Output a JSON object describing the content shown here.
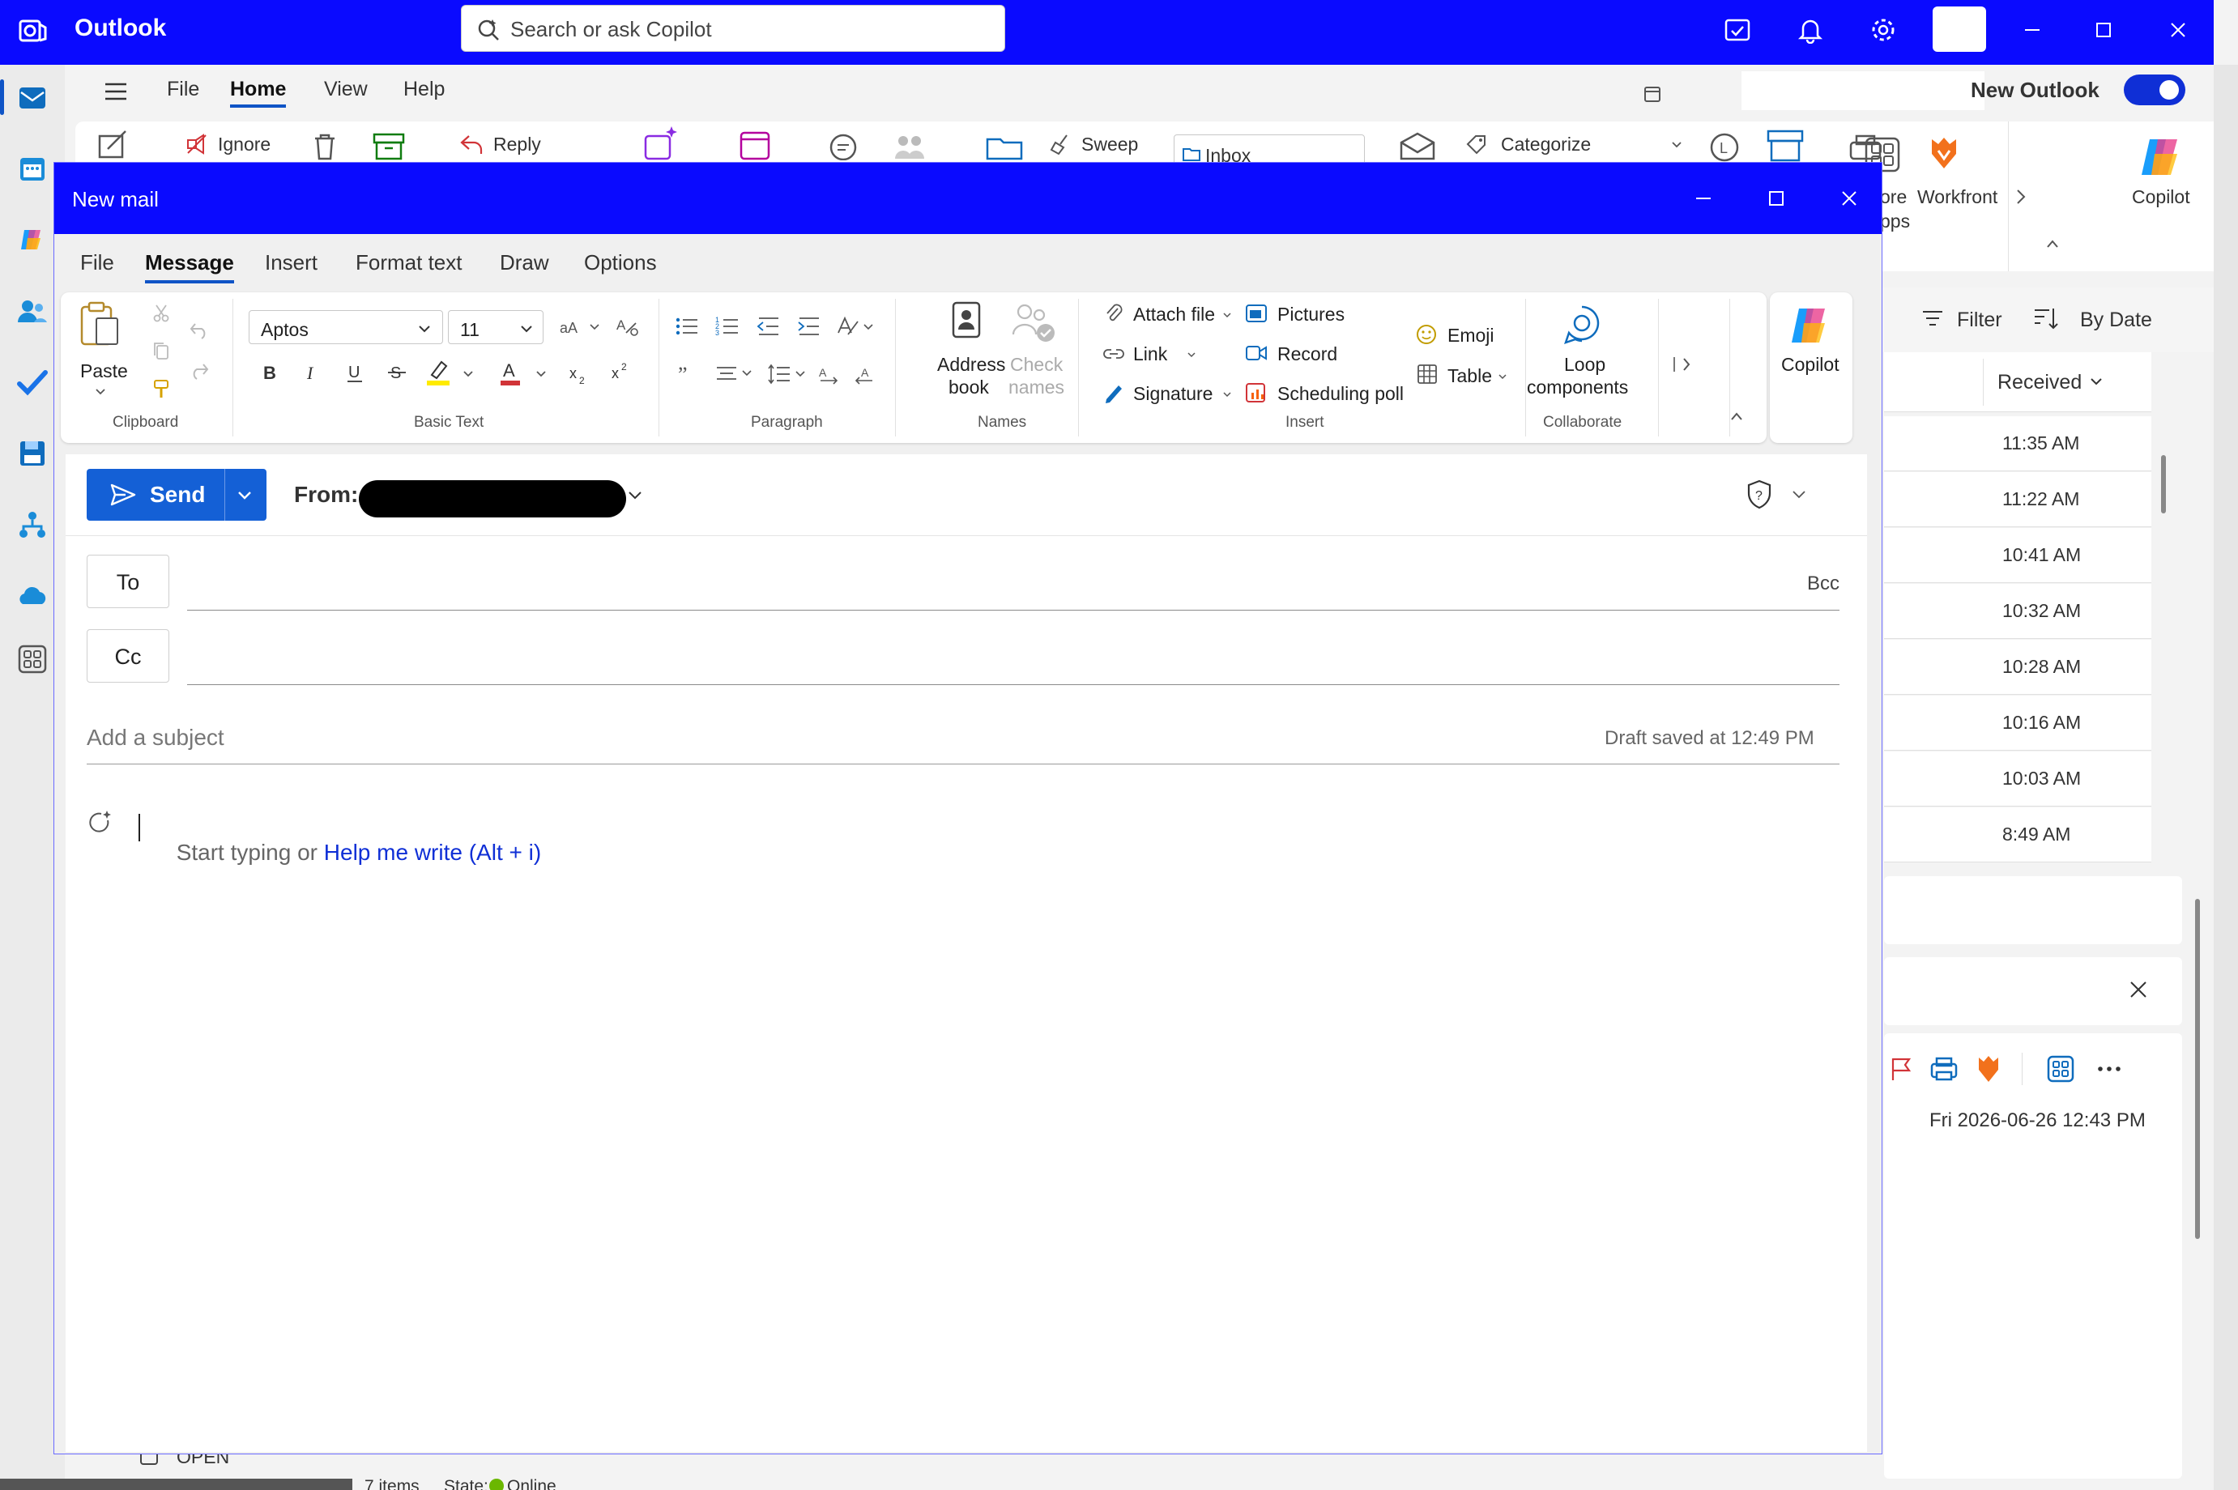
{
  "app": {
    "title": "Outlook",
    "search_placeholder": "Search or ask Copilot",
    "new_outlook_label": "New Outlook",
    "new_outlook_on": true
  },
  "outlook_menu": [
    "File",
    "Home",
    "View",
    "Help"
  ],
  "outlook_ribbon": {
    "ignore": "Ignore",
    "reply": "Reply",
    "sweep": "Sweep",
    "inbox": "Inbox",
    "categorize": "Categorize",
    "more_apps_a": "ore",
    "more_apps_b": "pps",
    "workfront": "Workfront",
    "copilot": "Copilot"
  },
  "message_list": {
    "filter": "Filter",
    "by_date": "By Date",
    "received": "Received",
    "times": [
      "11:35 AM",
      "11:22 AM",
      "10:41 AM",
      "10:32 AM",
      "10:28 AM",
      "10:16 AM",
      "10:03 AM",
      "8:49 AM"
    ],
    "reading_date": "Fri 2026-06-26 12:43 PM"
  },
  "status_bar": {
    "items": "7 items",
    "state": "State:",
    "online": "Online",
    "open": "OPEN"
  },
  "compose": {
    "window_title": "New mail",
    "tabs": [
      "File",
      "Message",
      "Insert",
      "Format text",
      "Draw",
      "Options"
    ],
    "ribbon": {
      "paste": "Paste",
      "clipboard": "Clipboard",
      "font_name": "Aptos",
      "font_size": "11",
      "basic_text": "Basic Text",
      "paragraph": "Paragraph",
      "address_book_1": "Address",
      "address_book_2": "book",
      "check_names_1": "Check",
      "check_names_2": "names",
      "names": "Names",
      "attach_file": "Attach file",
      "link": "Link",
      "signature": "Signature",
      "pictures": "Pictures",
      "record": "Record",
      "scheduling_poll": "Scheduling poll",
      "emoji": "Emoji",
      "table": "Table",
      "insert": "Insert",
      "loop_1": "Loop",
      "loop_2": "components",
      "collaborate": "Collaborate",
      "copilot": "Copilot"
    },
    "send": "Send",
    "from_label": "From:",
    "to": "To",
    "cc": "Cc",
    "bcc": "Bcc",
    "subject_placeholder": "Add a subject",
    "draft_saved": "Draft saved at 12:49 PM",
    "body_prompt": "Start typing or ",
    "help_me_write": "Help me write (Alt + i)"
  },
  "colors": {
    "titlebar": "#0a0aff",
    "send_button": "#1460d6",
    "link_blue": "#0f2fd6"
  }
}
